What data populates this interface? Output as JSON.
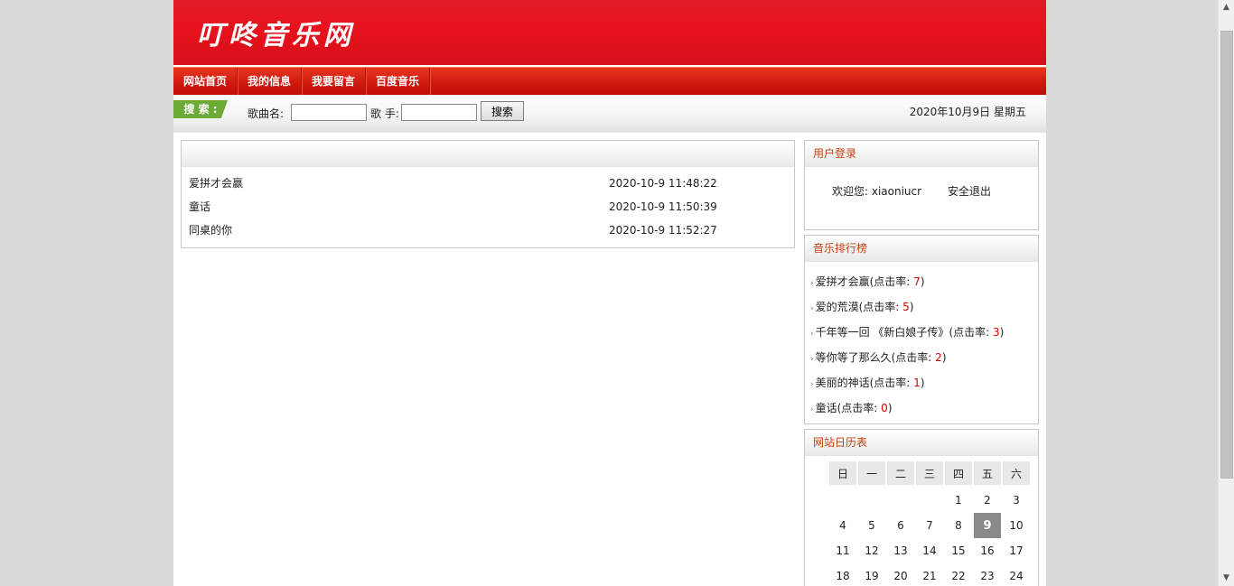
{
  "site": {
    "title": "叮咚音乐网"
  },
  "nav": {
    "items": [
      "网站首页",
      "我的信息",
      "我要留言",
      "百度音乐"
    ]
  },
  "search": {
    "tag": "搜 索 :",
    "song_label": "歌曲名:",
    "singer_label": "歌 手:",
    "song_value": "",
    "singer_value": "",
    "button": "搜索"
  },
  "date": "2020年10月9日 星期五",
  "songs": [
    {
      "name": "爱拼才会赢",
      "time": "2020-10-9 11:48:22"
    },
    {
      "name": "童话",
      "time": "2020-10-9 11:50:39"
    },
    {
      "name": "同桌的你",
      "time": "2020-10-9 11:52:27"
    }
  ],
  "login": {
    "title": "用户登录",
    "welcome": "欢迎您: xiaoniucr",
    "logout": "安全退出"
  },
  "ranking": {
    "title": "音乐排行榜",
    "items": [
      {
        "name": "爱拼才会赢",
        "count": "7"
      },
      {
        "name": "爱的荒漠",
        "count": "5"
      },
      {
        "name": "千年等一回 《新白娘子传》",
        "count": "3"
      },
      {
        "name": "等你等了那么久",
        "count": "2"
      },
      {
        "name": "美丽的神话",
        "count": "1"
      },
      {
        "name": "童话",
        "count": "0"
      }
    ],
    "prefix": "(点击率: ",
    "suffix": ")"
  },
  "calendar": {
    "title": "网站日历表",
    "weekdays": [
      "日",
      "一",
      "二",
      "三",
      "四",
      "五",
      "六"
    ],
    "rows": [
      [
        "",
        "",
        "",
        "",
        "1",
        "2",
        "3"
      ],
      [
        "4",
        "5",
        "6",
        "7",
        "8",
        "9",
        "10"
      ],
      [
        "11",
        "12",
        "13",
        "14",
        "15",
        "16",
        "17"
      ],
      [
        "18",
        "19",
        "20",
        "21",
        "22",
        "23",
        "24"
      ]
    ],
    "today": "9"
  },
  "scrollbar": {
    "up_icon": "▲",
    "down_icon": "▼"
  }
}
